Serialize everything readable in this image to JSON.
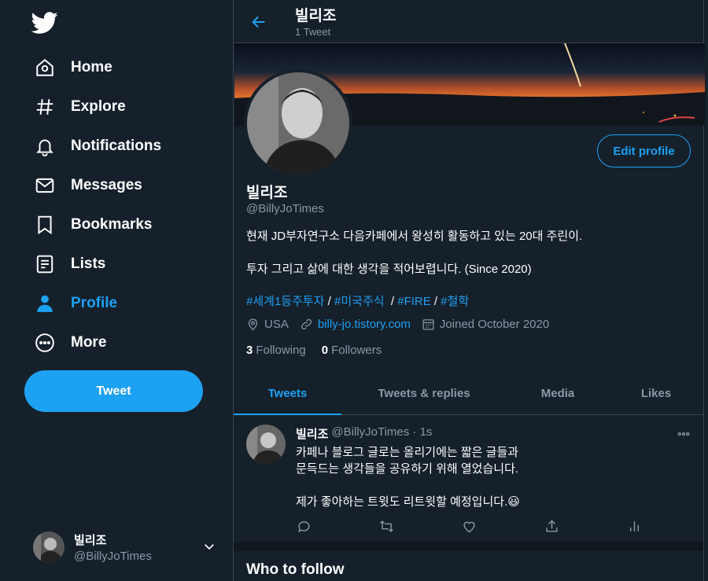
{
  "sidebar": {
    "items": [
      {
        "label": "Home"
      },
      {
        "label": "Explore"
      },
      {
        "label": "Notifications"
      },
      {
        "label": "Messages"
      },
      {
        "label": "Bookmarks"
      },
      {
        "label": "Lists"
      },
      {
        "label": "Profile"
      },
      {
        "label": "More"
      }
    ],
    "tweet_button": "Tweet",
    "account": {
      "name": "빌리조",
      "handle": "@BillyJoTimes"
    }
  },
  "header": {
    "title": "빌리조",
    "subtitle": "1 Tweet"
  },
  "profile": {
    "edit_button": "Edit profile",
    "name": "빌리조",
    "handle": "@BillyJoTimes",
    "bio_line1": "현재 JD부자연구소 다음카페에서 왕성히 활동하고 있는 20대 주린이.",
    "bio_line2": "투자 그리고 삶에 대한 생각을 적어보렵니다. (Since 2020)",
    "tags": {
      "t1": "#세계1등주투자",
      "s1": " / ",
      "t2": "#미국주식",
      "s2": "  / ",
      "t3": "#FIRE",
      "s3": " / ",
      "t4": "#철학"
    },
    "location": "USA",
    "website": "billy-jo.tistory.com",
    "joined": "Joined October 2020",
    "following_count": "3",
    "following_label": "Following",
    "followers_count": "0",
    "followers_label": "Followers"
  },
  "tabs": [
    {
      "label": "Tweets"
    },
    {
      "label": "Tweets & replies"
    },
    {
      "label": "Media"
    },
    {
      "label": "Likes"
    }
  ],
  "tweet": {
    "name": "빌리조",
    "handle": "@BillyJoTimes · 1s",
    "line1": "카페나 블로그 글로는 올리기에는 짧은 글들과",
    "line2": "문득드는 생각들을 공유하기 위해 열었습니다.",
    "line3": "제가 좋아하는 트윗도 리트윗할 예정입니다.",
    "emoji": "😃"
  },
  "who_to_follow": "Who to follow",
  "colors": {
    "accent": "#1da1f2",
    "background": "#15202b",
    "muted": "#8899a6",
    "border": "#38444d"
  }
}
